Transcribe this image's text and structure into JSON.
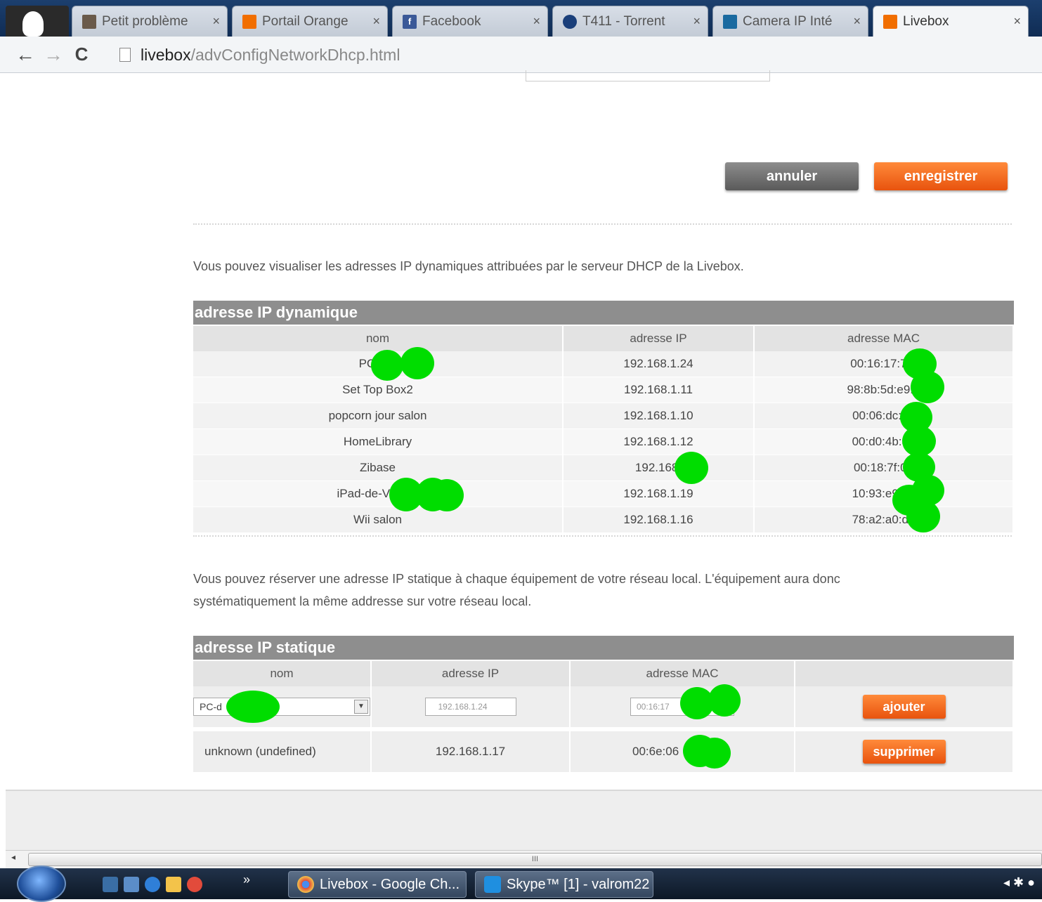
{
  "browser": {
    "tabs": [
      {
        "title": "Petit problème",
        "favicon": "forum-icon",
        "color": "#6a5a4a"
      },
      {
        "title": "Portail Orange",
        "favicon": "orange-icon",
        "color": "#f16e00"
      },
      {
        "title": "Facebook",
        "favicon": "facebook-icon",
        "color": "#3b5998"
      },
      {
        "title": "T411 - Torrent",
        "favicon": "torrent-icon",
        "color": "#1a3f7a"
      },
      {
        "title": "Camera IP Inté",
        "favicon": "camera-icon",
        "color": "#1a6aa0"
      },
      {
        "title": "Livebox",
        "favicon": "orange-icon",
        "color": "#f16e00"
      }
    ],
    "close_glyph": "×",
    "url_host": "livebox",
    "url_path": "/advConfigNetworkDhcp.html"
  },
  "actions": {
    "cancel": "annuler",
    "save": "enregistrer"
  },
  "dynamic": {
    "intro": "Vous pouvez visualiser les adresses IP dynamiques attribuées par le serveur DHCP de la Livebox.",
    "title": "adresse IP dynamique",
    "headers": [
      "nom",
      "adresse IP",
      "adresse MAC"
    ],
    "rows": [
      {
        "name": "PC-de-",
        "ip": "192.168.1.24",
        "mac": "00:16:17:71:"
      },
      {
        "name": "Set Top Box2",
        "ip": "192.168.1.11",
        "mac": "98:8b:5d:e9:1"
      },
      {
        "name": "popcorn jour salon",
        "ip": "192.168.1.10",
        "mac": "00:06:dc:81"
      },
      {
        "name": "HomeLibrary",
        "ip": "192.168.1.12",
        "mac": "00:d0:4b:89"
      },
      {
        "name": "Zibase",
        "ip": "192.168.",
        "mac": "00:18:7f:00"
      },
      {
        "name": "iPad-de-Valerie",
        "ip": "192.168.1.19",
        "mac": "10:93:e9:17"
      },
      {
        "name": "Wii salon",
        "ip": "192.168.1.16",
        "mac": "78:a2:a0:d5"
      }
    ]
  },
  "static": {
    "intro_line1": "Vous pouvez réserver une adresse IP statique à chaque équipement de votre réseau local. L'équipement aura donc",
    "intro_line2": "systématiquement la même addresse sur votre réseau local.",
    "title": "adresse IP statique",
    "headers": [
      "nom",
      "adresse IP",
      "adresse MAC",
      ""
    ],
    "form": {
      "name_value": "PC-d",
      "ip_value": "192.168.1.24",
      "mac_value": "00:16:17",
      "add": "ajouter"
    },
    "rows": [
      {
        "name": "unknown (undefined)",
        "ip": "192.168.1.17",
        "mac": "00:6e:06",
        "delete": "supprimer"
      }
    ]
  },
  "scrollbar": {
    "grip": "III"
  },
  "taskbar": {
    "windows": [
      {
        "label": "Livebox - Google Ch...",
        "icon": "chrome-icon"
      },
      {
        "label": "Skype™ [1] - valrom22",
        "icon": "skype-icon"
      }
    ],
    "overflow": "»"
  }
}
